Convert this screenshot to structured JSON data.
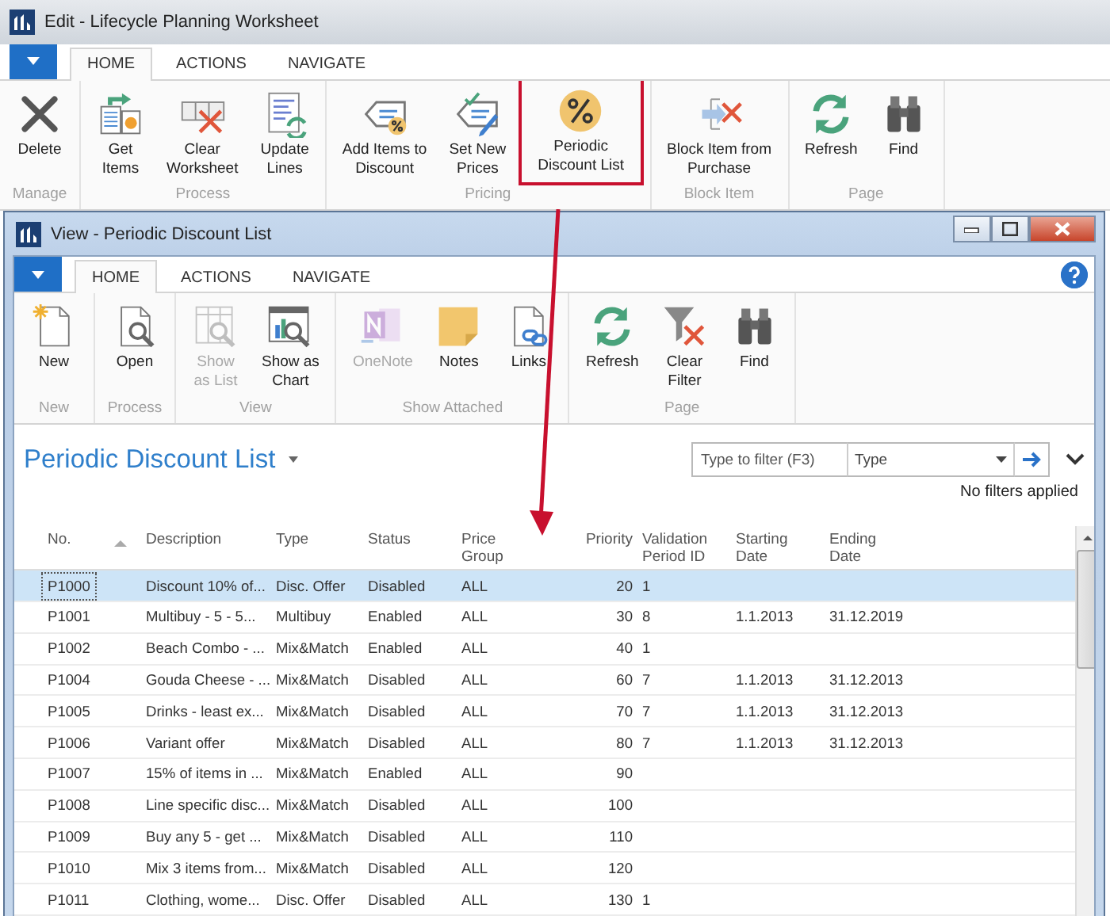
{
  "outer_window": {
    "title": "Edit - Lifecycle Planning Worksheet",
    "tabs": [
      {
        "label": "HOME",
        "selected": true
      },
      {
        "label": "ACTIONS",
        "selected": false
      },
      {
        "label": "NAVIGATE",
        "selected": false
      }
    ],
    "ribbon": [
      {
        "label": "Manage",
        "buttons": [
          {
            "label": "Delete",
            "disabled": false,
            "highlighted": false
          }
        ]
      },
      {
        "label": "Process",
        "buttons": [
          {
            "label": "Get\nItems",
            "disabled": false,
            "highlighted": false
          },
          {
            "label": "Clear\nWorksheet",
            "disabled": false,
            "highlighted": false
          },
          {
            "label": "Update\nLines",
            "disabled": false,
            "highlighted": false
          }
        ]
      },
      {
        "label": "Pricing",
        "buttons": [
          {
            "label": "Add Items to\nDiscount",
            "disabled": false,
            "highlighted": false
          },
          {
            "label": "Set New\nPrices",
            "disabled": false,
            "highlighted": false
          },
          {
            "label": "Periodic\nDiscount List",
            "disabled": false,
            "highlighted": true
          }
        ]
      },
      {
        "label": "Block Item",
        "buttons": [
          {
            "label": "Block Item from\nPurchase",
            "disabled": false,
            "highlighted": false
          }
        ]
      },
      {
        "label": "Page",
        "buttons": [
          {
            "label": "Refresh",
            "disabled": false,
            "highlighted": false
          },
          {
            "label": "Find",
            "disabled": false,
            "highlighted": false
          }
        ]
      }
    ]
  },
  "list_window": {
    "title": "View - Periodic Discount List",
    "tabs": [
      {
        "label": "HOME",
        "selected": true
      },
      {
        "label": "ACTIONS",
        "selected": false
      },
      {
        "label": "NAVIGATE",
        "selected": false
      }
    ],
    "ribbon": [
      {
        "label": "New",
        "buttons": [
          {
            "label": "New",
            "disabled": false,
            "highlighted": false
          }
        ]
      },
      {
        "label": "Process",
        "buttons": [
          {
            "label": "Open",
            "disabled": false,
            "highlighted": false
          }
        ]
      },
      {
        "label": "View",
        "buttons": [
          {
            "label": "Show\nas List",
            "disabled": true,
            "highlighted": false
          },
          {
            "label": "Show as\nChart",
            "disabled": false,
            "highlighted": false
          }
        ]
      },
      {
        "label": "Show Attached",
        "buttons": [
          {
            "label": "OneNote",
            "disabled": true,
            "highlighted": false
          },
          {
            "label": "Notes",
            "disabled": false,
            "highlighted": false
          },
          {
            "label": "Links",
            "disabled": false,
            "highlighted": false
          }
        ]
      },
      {
        "label": "Page",
        "buttons": [
          {
            "label": "Refresh",
            "disabled": false,
            "highlighted": false
          },
          {
            "label": "Clear\nFilter",
            "disabled": false,
            "highlighted": false
          },
          {
            "label": "Find",
            "disabled": false,
            "highlighted": false
          }
        ]
      }
    ],
    "page_title": "Periodic Discount List",
    "filter": {
      "placeholder": "Type to filter (F3)",
      "field": "Type"
    },
    "filter_status": "No filters applied",
    "table": {
      "columns": [
        {
          "label": "No.",
          "sorted": true,
          "kind": "text"
        },
        {
          "label": "Description",
          "sorted": false,
          "kind": "text"
        },
        {
          "label": "Type",
          "sorted": false,
          "kind": "text"
        },
        {
          "label": "Status",
          "sorted": false,
          "kind": "text"
        },
        {
          "label": "Price\nGroup",
          "sorted": false,
          "kind": "text"
        },
        {
          "label": "Priority",
          "sorted": false,
          "kind": "number"
        },
        {
          "label": "Validation\nPeriod ID",
          "sorted": false,
          "kind": "text"
        },
        {
          "label": "Starting\nDate",
          "sorted": false,
          "kind": "text"
        },
        {
          "label": "Ending\nDate",
          "sorted": false,
          "kind": "text"
        }
      ],
      "rows": [
        {
          "selected": true,
          "cells": [
            "P1000",
            "Discount 10% of...",
            "Disc. Offer",
            "Disabled",
            "ALL",
            "20",
            "1",
            null,
            null
          ]
        },
        {
          "selected": false,
          "cells": [
            "P1001",
            "Multibuy -  5 - 5...",
            "Multibuy",
            "Enabled",
            "ALL",
            "30",
            "8",
            "1.1.2013",
            "31.12.2019"
          ]
        },
        {
          "selected": false,
          "cells": [
            "P1002",
            "Beach Combo - ...",
            "Mix&Match",
            "Enabled",
            "ALL",
            "40",
            "1",
            null,
            null
          ]
        },
        {
          "selected": false,
          "cells": [
            "P1004",
            "Gouda Cheese - ...",
            "Mix&Match",
            "Disabled",
            "ALL",
            "60",
            "7",
            "1.1.2013",
            "31.12.2013"
          ]
        },
        {
          "selected": false,
          "cells": [
            "P1005",
            "Drinks - least ex...",
            "Mix&Match",
            "Disabled",
            "ALL",
            "70",
            "7",
            "1.1.2013",
            "31.12.2013"
          ]
        },
        {
          "selected": false,
          "cells": [
            "P1006",
            "Variant offer",
            "Mix&Match",
            "Disabled",
            "ALL",
            "80",
            "7",
            "1.1.2013",
            "31.12.2013"
          ]
        },
        {
          "selected": false,
          "cells": [
            "P1007",
            "15% of items in ...",
            "Mix&Match",
            "Enabled",
            "ALL",
            "90",
            null,
            null,
            null
          ]
        },
        {
          "selected": false,
          "cells": [
            "P1008",
            "Line specific disc...",
            "Mix&Match",
            "Disabled",
            "ALL",
            "100",
            null,
            null,
            null
          ]
        },
        {
          "selected": false,
          "cells": [
            "P1009",
            "Buy any 5 - get ...",
            "Mix&Match",
            "Disabled",
            "ALL",
            "110",
            null,
            null,
            null
          ]
        },
        {
          "selected": false,
          "cells": [
            "P1010",
            "Mix 3 items from...",
            "Mix&Match",
            "Disabled",
            "ALL",
            "120",
            null,
            null,
            null
          ]
        },
        {
          "selected": false,
          "cells": [
            "P1011",
            "Clothing, wome...",
            "Disc. Offer",
            "Disabled",
            "ALL",
            "130",
            "1",
            null,
            null
          ]
        }
      ]
    }
  }
}
